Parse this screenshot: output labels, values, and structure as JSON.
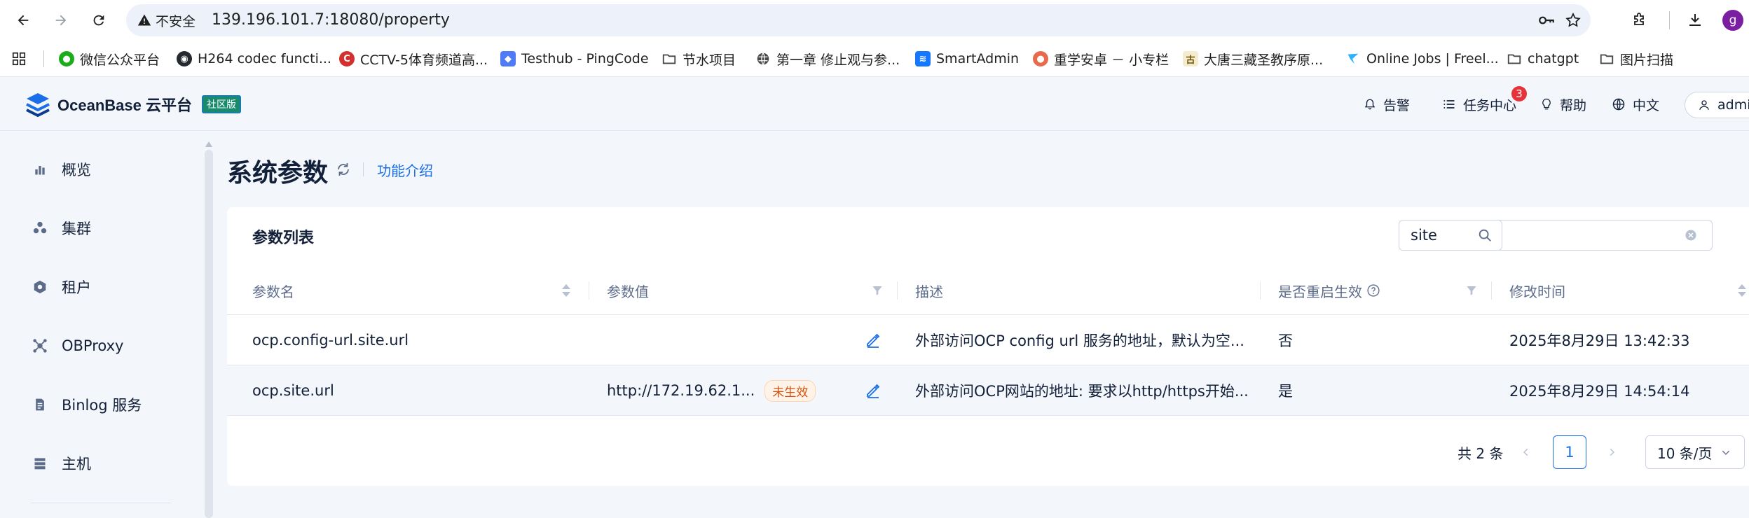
{
  "browser": {
    "security_label": "不安全",
    "url": "139.196.101.7:18080/property",
    "profile_initial": "g"
  },
  "bookmarks": [
    {
      "label": "微信公众平台",
      "icon": "wechat-icon",
      "color": "#1aad19"
    },
    {
      "label": "H264 codec functi...",
      "icon": "github-icon",
      "color": "#24292f"
    },
    {
      "label": "CCTV-5体育频道高...",
      "icon": "cctv-icon",
      "color": "#d32f2f"
    },
    {
      "label": "Testhub - PingCode",
      "icon": "pingcode-icon",
      "color": "#4f7bf7"
    },
    {
      "label": "节水项目",
      "icon": "folder-icon",
      "color": "#444746"
    },
    {
      "label": "第一章 修止观与参...",
      "icon": "globe-icon",
      "color": "#444746"
    },
    {
      "label": "SmartAdmin",
      "icon": "smartadmin-icon",
      "color": "#1677ff"
    },
    {
      "label": "重学安卓 － 小专栏",
      "icon": "xiaozhuanlan-icon",
      "color": "#e86a4c"
    },
    {
      "label": "大唐三藏圣教序原...",
      "icon": "gu-icon",
      "color": "#c9a227"
    },
    {
      "label": "Online Jobs | Freel...",
      "icon": "freelancer-icon",
      "color": "#29b2fe"
    },
    {
      "label": "chatgpt",
      "icon": "folder-icon",
      "color": "#444746"
    },
    {
      "label": "图片扫描",
      "icon": "folder-icon",
      "color": "#444746"
    }
  ],
  "header": {
    "logo_text": "OceanBase 云平台",
    "edition": "社区版",
    "alerts": "告警",
    "tasks": "任务中心",
    "tasks_badge": "3",
    "help": "帮助",
    "language": "中文",
    "user": "admin"
  },
  "sidebar": {
    "items": [
      {
        "label": "概览",
        "icon": "bar-chart-icon"
      },
      {
        "label": "集群",
        "icon": "cluster-icon"
      },
      {
        "label": "租户",
        "icon": "tenant-icon"
      },
      {
        "label": "OBProxy",
        "icon": "proxy-icon"
      },
      {
        "label": "Binlog 服务",
        "icon": "binlog-icon"
      },
      {
        "label": "主机",
        "icon": "host-icon"
      }
    ]
  },
  "page": {
    "title": "系统参数",
    "intro_link": "功能介绍"
  },
  "card": {
    "title": "参数列表",
    "search_value": "site",
    "columns": [
      "参数名",
      "参数值",
      "描述",
      "是否重启生效",
      "修改时间"
    ],
    "rows": [
      {
        "name": "ocp.config-url.site.url",
        "value": "",
        "tag": "",
        "description": "外部访问OCP config url 服务的地址，默认为空...",
        "restart": "否",
        "modified": "2025年8月29日 13:42:33"
      },
      {
        "name": "ocp.site.url",
        "value": "http://172.19.62.1...",
        "tag": "未生效",
        "description": "外部访问OCP网站的地址: 要求以http/https开始...",
        "restart": "是",
        "modified": "2025年8月29日 14:54:14"
      }
    ]
  },
  "pagination": {
    "total": "共 2 条",
    "current_page": "1",
    "page_size": "10 条/页"
  },
  "colors": {
    "accent": "#1a6fe8",
    "warning_tag": "#d2520f",
    "badge": "#e8323a"
  }
}
